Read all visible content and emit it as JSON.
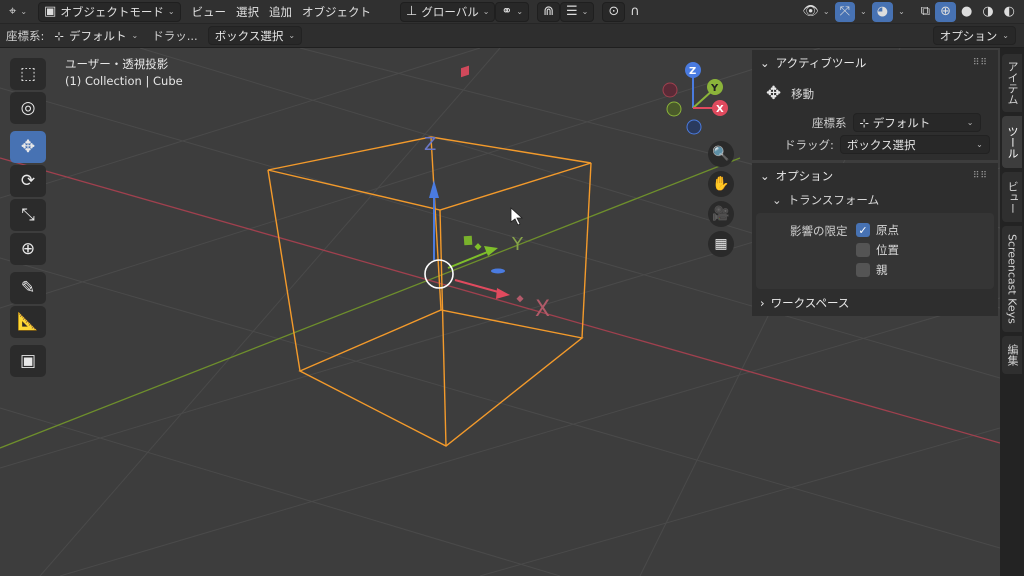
{
  "header": {
    "editor_type_icon": "axis-gizmo-icon",
    "mode_label": "オブジェクトモード",
    "menus": [
      "ビュー",
      "選択",
      "追加",
      "オブジェクト"
    ],
    "orientation_label": "グローバル",
    "pivot_icon": "link-pivot-icon",
    "snap_icon": "magnet-icon",
    "proportional_icon": "proportional-edit-icon"
  },
  "tool_settings": {
    "orientation_label": "座標系:",
    "orientation_value": "デフォルト",
    "drag_label": "ドラッ...",
    "drag_value": "ボックス選択",
    "options_label": "オプション"
  },
  "viewport": {
    "view_name": "ユーザー・透視投影",
    "object_info": "(1) Collection | Cube",
    "gizmo_labels": {
      "x": "X",
      "y": "Y",
      "z": "Z"
    },
    "grid_line_color": "#4a4a4a",
    "x_axis_color": "#a0404e",
    "y_axis_color": "#6e8f2c",
    "selection_color": "#f39a2b"
  },
  "tools": [
    {
      "name": "select-box-tool",
      "icon": "select-box-icon",
      "glyph": "⬚"
    },
    {
      "name": "cursor-tool",
      "icon": "cursor-icon",
      "glyph": "◎"
    },
    {
      "name": "move-tool",
      "icon": "move-icon",
      "glyph": "✥"
    },
    {
      "name": "rotate-tool",
      "icon": "rotate-icon",
      "glyph": "⟳"
    },
    {
      "name": "scale-tool",
      "icon": "scale-icon",
      "glyph": "⤡"
    },
    {
      "name": "transform-tool",
      "icon": "transform-icon",
      "glyph": "⊕"
    },
    {
      "name": "annotate-tool",
      "icon": "annotate-icon",
      "glyph": "✎"
    },
    {
      "name": "measure-tool",
      "icon": "measure-icon",
      "glyph": "📐"
    },
    {
      "name": "add-cube-tool",
      "icon": "add-cube-icon",
      "glyph": "▣"
    }
  ],
  "sidebar": {
    "active_tool": {
      "title": "アクティブツール",
      "tool_name": "移動",
      "orientation_label": "座標系",
      "orientation_value": "デフォルト",
      "drag_label": "ドラッグ:",
      "drag_value": "ボックス選択"
    },
    "options": {
      "title": "オプション",
      "transform_title": "トランスフォーム",
      "affect_only_label": "影響の限定",
      "checkboxes": [
        {
          "label": "原点",
          "checked": true
        },
        {
          "label": "位置",
          "checked": false
        },
        {
          "label": "親",
          "checked": false
        }
      ]
    },
    "workspace": {
      "title": "ワークスペース"
    }
  },
  "tabs": [
    "アイテム",
    "ツール",
    "ビュー",
    "Screencast Keys",
    "編集"
  ]
}
